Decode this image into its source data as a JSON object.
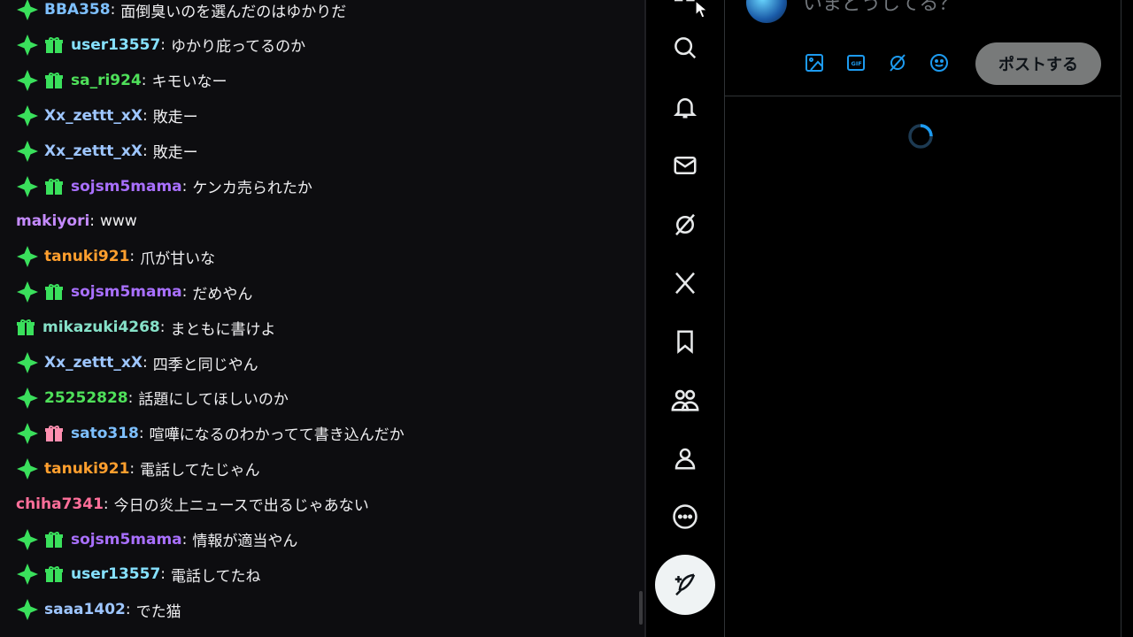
{
  "chat": {
    "messages": [
      {
        "badges": [
          "verified"
        ],
        "user": "BBA358",
        "color": "#7ec0ff",
        "text": "面倒臭いのを選んだのはゆかりだ"
      },
      {
        "badges": [
          "verified",
          "gift-green"
        ],
        "user": "user13557",
        "color": "#86e1ff",
        "text": "ゆかり庇ってるのか"
      },
      {
        "badges": [
          "verified",
          "gift-green"
        ],
        "user": "sa_ri924",
        "color": "#4fe05a",
        "text": "キモいなー"
      },
      {
        "badges": [
          "verified"
        ],
        "user": "Xx_zettt_xX",
        "color": "#9ec6ff",
        "text": "敗走ー"
      },
      {
        "badges": [
          "verified"
        ],
        "user": "Xx_zettt_xX",
        "color": "#9ec6ff",
        "text": "敗走ー"
      },
      {
        "badges": [
          "verified",
          "gift-green"
        ],
        "user": "sojsm5mama",
        "color": "#a970ff",
        "text": "ケンカ売られたか"
      },
      {
        "badges": [],
        "user": "makiyori",
        "color": "#c58bff",
        "text": "www"
      },
      {
        "badges": [
          "verified"
        ],
        "user": "tanuki921",
        "color": "#ff9f2e",
        "text": "爪が甘いな"
      },
      {
        "badges": [
          "verified",
          "gift-green"
        ],
        "user": "sojsm5mama",
        "color": "#a970ff",
        "text": "だめやん"
      },
      {
        "badges": [
          "gift-green"
        ],
        "user": "mikazuki4268",
        "color": "#86e1c8",
        "text": "まともに書けよ"
      },
      {
        "badges": [
          "verified"
        ],
        "user": "Xx_zettt_xX",
        "color": "#9ec6ff",
        "text": "四季と同じやん"
      },
      {
        "badges": [
          "verified"
        ],
        "user": "25252828",
        "color": "#4fe05a",
        "text": "話題にしてほしいのか"
      },
      {
        "badges": [
          "verified",
          "gift-pink"
        ],
        "user": "sato318",
        "color": "#7ec0ff",
        "text": "喧嘩になるのわかってて書き込んだか"
      },
      {
        "badges": [
          "verified"
        ],
        "user": "tanuki921",
        "color": "#ff9f2e",
        "text": "電話してたじゃん"
      },
      {
        "badges": [],
        "user": "chiha7341",
        "color": "#ff6f9a",
        "text": "今日の炎上ニュースで出るじゃあない"
      },
      {
        "badges": [
          "verified",
          "gift-green"
        ],
        "user": "sojsm5mama",
        "color": "#a970ff",
        "text": "情報が適当やん"
      },
      {
        "badges": [
          "verified",
          "gift-green"
        ],
        "user": "user13557",
        "color": "#86e1ff",
        "text": "電話してたね"
      },
      {
        "badges": [
          "verified"
        ],
        "user": "saaa1402",
        "color": "#9ec6ff",
        "text": "でた猫"
      }
    ]
  },
  "xnav": {
    "icons": [
      "search-icon",
      "notifications-icon",
      "messages-icon",
      "grok-icon",
      "x-logo-icon",
      "bookmarks-icon",
      "communities-icon",
      "profile-icon",
      "more-icon"
    ],
    "post_fab_icon": "compose-icon"
  },
  "composer": {
    "placeholder": "いまどうしてる？",
    "post_label": "ポストする",
    "tools": [
      "media-icon",
      "gif-icon",
      "grok-icon",
      "emoji-icon"
    ],
    "accent": "#1d9bf0"
  }
}
